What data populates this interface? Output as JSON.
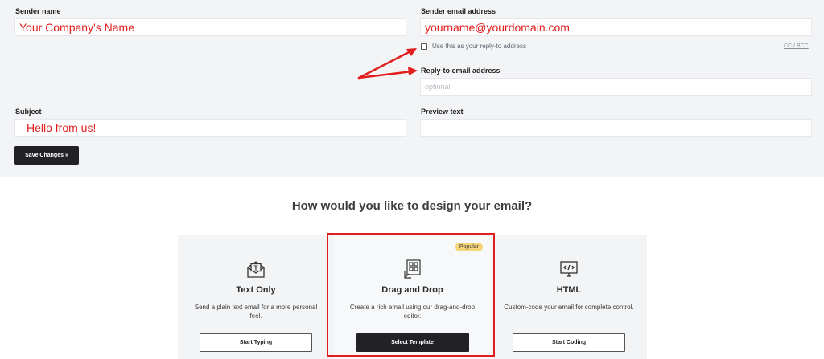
{
  "form": {
    "sender_name_label": "Sender name",
    "sender_name_value": "Your Company's Name",
    "sender_email_label": "Sender email address",
    "sender_email_value": "yourname@yourdomain.com",
    "use_reply_to_label": "Use this as your reply-to address",
    "cc_bcc_link": "CC / BCC",
    "reply_to_label": "Reply-to email address",
    "reply_to_placeholder": "optional",
    "subject_label": "Subject",
    "subject_value": "Hello from us!",
    "preview_text_label": "Preview text",
    "preview_text_value": "",
    "save_button": "Save Changes »"
  },
  "design": {
    "title": "How would you like to design your email?",
    "cards": [
      {
        "title": "Text Only",
        "description": "Send a plain text email for a more personal feel.",
        "button": "Start Typing",
        "icon": "envelope-text-icon"
      },
      {
        "title": "Drag and Drop",
        "description": "Create a rich email using our drag-and-drop editor.",
        "button": "Select Template",
        "badge": "Popular",
        "icon": "drag-drop-layout-icon"
      },
      {
        "title": "HTML",
        "description": "Custom-code your email for complete control.",
        "button": "Start Coding",
        "icon": "monitor-code-icon"
      }
    ]
  },
  "colors": {
    "annotation_red": "#e11d1d",
    "dark_button": "#222226",
    "popular_badge": "#f5d479",
    "form_background": "#f3f4f6"
  }
}
